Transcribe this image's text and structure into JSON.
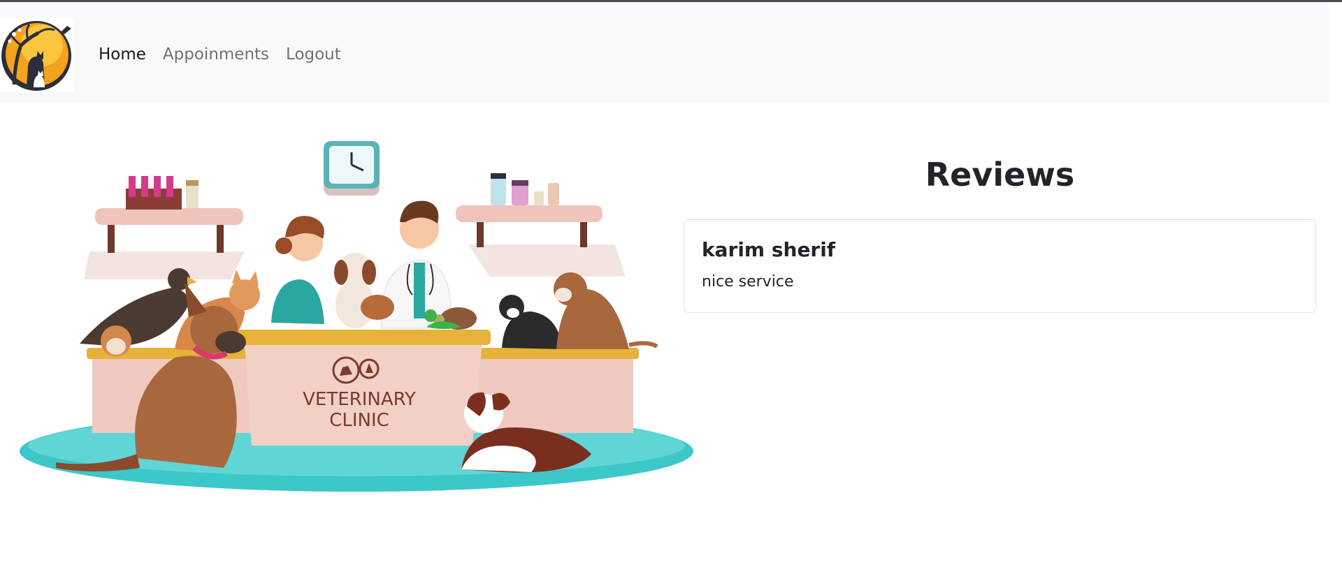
{
  "nav": {
    "logo_icon": "veterinary-clinic-logo",
    "links": [
      {
        "label": "Home",
        "active": true
      },
      {
        "label": "Appoinments",
        "active": false
      },
      {
        "label": "Logout",
        "active": false
      }
    ]
  },
  "hero": {
    "sign_line1": "VETERINARY",
    "sign_line2": "CLINIC",
    "clock_icon": "clock-icon"
  },
  "reviews": {
    "title": "Reviews",
    "items": [
      {
        "name": "karim sherif",
        "text": "nice service"
      }
    ]
  },
  "colors": {
    "navbar_bg": "#f8f9fa",
    "logo_orange": "#f5a21d",
    "floor_teal": "#3cc7c9",
    "counter_gold": "#e6b23a",
    "counter_pink": "#efc9c0"
  }
}
